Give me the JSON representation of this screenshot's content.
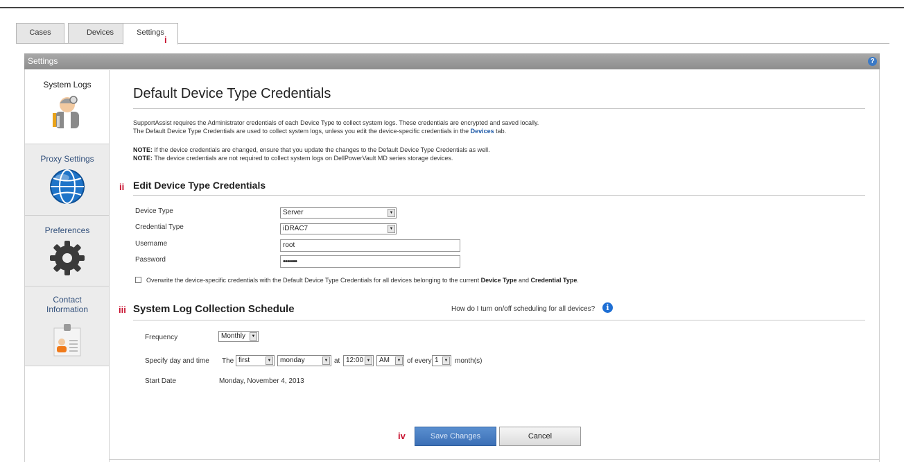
{
  "tabs": [
    {
      "label": "Cases"
    },
    {
      "label": "Devices"
    },
    {
      "label": "Settings"
    }
  ],
  "tab_marker": "i",
  "settings_bar": {
    "title": "Settings",
    "help": "?"
  },
  "sidebar": {
    "items": [
      {
        "label": "System Logs",
        "icon": "technician-icon"
      },
      {
        "label": "Proxy Settings",
        "icon": "globe-icon"
      },
      {
        "label": "Preferences",
        "icon": "gear-icon"
      },
      {
        "label": "Contact Information",
        "icon": "contact-card-icon"
      }
    ]
  },
  "page": {
    "title": "Default Device Type Credentials",
    "intro_line1": "SupportAssist requires the Administrator credentials of each Device Type to collect system logs. These credentials are encrypted and saved locally.",
    "intro_line2_pre": "The Default Device Type Credentials are used to collect system logs, unless you edit the device-specific credentials in the",
    "intro_line2_link": "Devices",
    "intro_line2_post": "tab.",
    "note_label": "NOTE:",
    "note1": "If the device credentials are changed, ensure that you update the changes to the Default Device Type Credentials as well.",
    "note2": "The device credentials are not required to collect system logs on DellPowerVault MD series storage devices."
  },
  "edit_section": {
    "marker": "ii",
    "title": "Edit Device Type Credentials",
    "device_type_label": "Device Type",
    "device_type_value": "Server",
    "credential_type_label": "Credential Type",
    "credential_type_value": "iDRAC7",
    "username_label": "Username",
    "username_value": "root",
    "password_label": "Password",
    "password_value": "•••••••",
    "overwrite_pre": "Overwrite the device-specific credentials with the Default Device Type Credentials for all devices belonging to the current",
    "overwrite_b1": "Device Type",
    "overwrite_mid": "and",
    "overwrite_b2": "Credential Type",
    "overwrite_end": "."
  },
  "schedule_section": {
    "marker": "iii",
    "title": "System Log Collection Schedule",
    "help_text": "How do I turn on/off scheduling for all devices?",
    "frequency_label": "Frequency",
    "frequency_value": "Monthly",
    "daytime_label": "Specify day and time",
    "the_label": "The",
    "ordinal_value": "first",
    "weekday_value": "monday",
    "at_label": "at",
    "time_value": "12:00",
    "ampm_value": "AM",
    "of_every_label": "of every",
    "interval_value": "1",
    "months_label": "month(s)",
    "start_date_label": "Start Date",
    "start_date_value": "Monday, November 4, 2013"
  },
  "actions": {
    "marker": "iv",
    "save_label": "Save Changes",
    "cancel_label": "Cancel"
  },
  "colors": {
    "accent": "#3b6fb6",
    "marker": "#c8102e",
    "header_bar": "#9a9a9a"
  }
}
